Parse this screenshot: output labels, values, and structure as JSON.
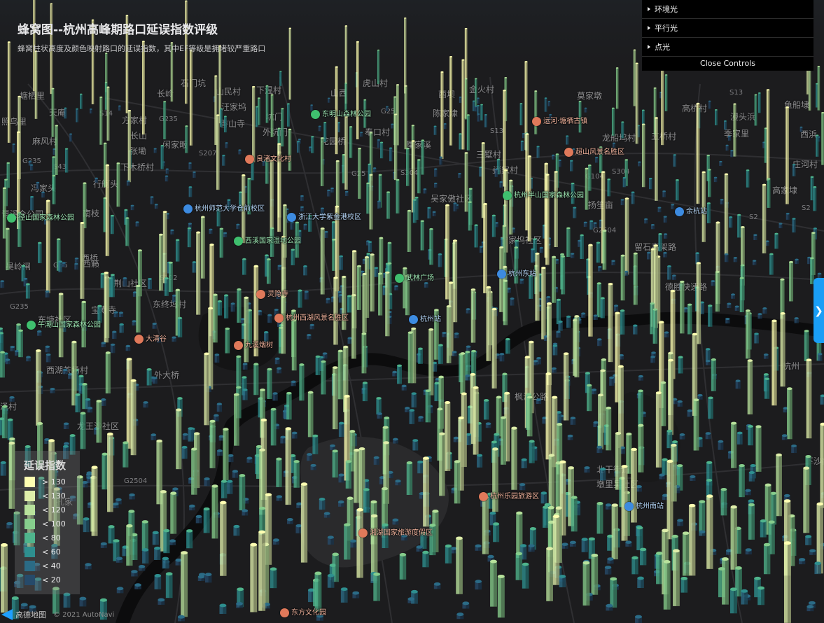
{
  "title": "蜂窝图--杭州高峰期路口延误指数评级",
  "subtitle": "蜂窝柱状高度及颜色映射路口的延误指数，其中EF等级是拥堵较严重路口",
  "controls": {
    "folders": [
      "环境光",
      "平行光",
      "点光"
    ],
    "close_label": "Close Controls"
  },
  "side_tab_label": "❯",
  "legend": {
    "title": "延误指数",
    "items": [
      {
        "label": "> 130",
        "color": "#ffffb2"
      },
      {
        "label": "< 130",
        "color": "#dfeeaa"
      },
      {
        "label": "< 120",
        "color": "#b8e29c"
      },
      {
        "label": "< 100",
        "color": "#86cd8c"
      },
      {
        "label": "< 80",
        "color": "#4fb48c"
      },
      {
        "label": "< 60",
        "color": "#2e8f8f"
      },
      {
        "label": "< 40",
        "color": "#2b6b86"
      },
      {
        "label": "< 20",
        "color": "#264a6a"
      }
    ]
  },
  "map": {
    "places": [
      "塘栖里",
      "天庵",
      "照鸟里",
      "麻风村",
      "S14",
      "长岭",
      "方家村",
      "G235",
      "长山",
      "张墈",
      "闲家畈",
      "下木桥村",
      "S207",
      "G235",
      "S43",
      "冯家头",
      "行舸头",
      "青溪合公园",
      "南枝",
      "西桥",
      "石门坑",
      "山民村",
      "汪家坞",
      "香山寺",
      "外坑门",
      "坑门",
      "下温村",
      "山西",
      "虎山村",
      "G25",
      "花园桥",
      "奉口村",
      "G25",
      "S304",
      "厘家溪",
      "西坝",
      "陈家埭",
      "金火村",
      "S13",
      "三墅村",
      "诸家村",
      "吴家傲社区",
      "S13",
      "莫家墩",
      "高桥村",
      "漫头浜",
      "鱼船埭",
      "S13",
      "龙船坞村",
      "五桥村",
      "季家里",
      "西浜",
      "庄河村",
      "高家埭",
      "S2",
      "S2",
      "G104",
      "S304",
      "扬笙亩",
      "G2504",
      "宁家坞社区",
      "留石高架路",
      "昊岭闸",
      "G56",
      "西籁",
      "荆山社区",
      "S102",
      "东终坞村",
      "宝寿寺",
      "G235",
      "东塘社区",
      "西湖茶场村",
      "外大桥",
      "泽村",
      "龙王沙社区",
      "G2504",
      "孔家",
      "枫汤公路",
      "北干街道",
      "墩里吴社区",
      "德胜快速路",
      "杭州",
      "下沙南高速"
    ],
    "pois": [
      {
        "name": "径山国家森林公园",
        "kind": "green"
      },
      {
        "name": "东明山森林公园",
        "kind": "green"
      },
      {
        "name": "良渚文化村",
        "kind": "orange"
      },
      {
        "name": "杭州师范大学仓前校区",
        "kind": "blue"
      },
      {
        "name": "浙江大学紫金港校区",
        "kind": "blue"
      },
      {
        "name": "西溪国家湿地公园",
        "kind": "green"
      },
      {
        "name": "杭州半山国家森林公园",
        "kind": "green"
      },
      {
        "name": "超山风景名胜区",
        "kind": "orange"
      },
      {
        "name": "运河·塘栖古镇",
        "kind": "orange"
      },
      {
        "name": "余杭站",
        "kind": "blue"
      },
      {
        "name": "杭州东站",
        "kind": "blue"
      },
      {
        "name": "杭州站",
        "kind": "blue"
      },
      {
        "name": "灵隐寺",
        "kind": "orange"
      },
      {
        "name": "杭州西湖风景名胜区",
        "kind": "orange"
      },
      {
        "name": "九溪烟树",
        "kind": "orange"
      },
      {
        "name": "午潮山国家森林公园",
        "kind": "green"
      },
      {
        "name": "大清谷",
        "kind": "orange"
      },
      {
        "name": "武林广场",
        "kind": "green"
      },
      {
        "name": "杭州乐园旅游区",
        "kind": "orange"
      },
      {
        "name": "湘湖国家旅游度假区",
        "kind": "orange"
      },
      {
        "name": "杭州南站",
        "kind": "blue"
      },
      {
        "name": "东方文化园",
        "kind": "orange"
      }
    ]
  },
  "attribution": {
    "logo_text": "高德地图",
    "copyright": "© 2021 AutoNavi"
  }
}
